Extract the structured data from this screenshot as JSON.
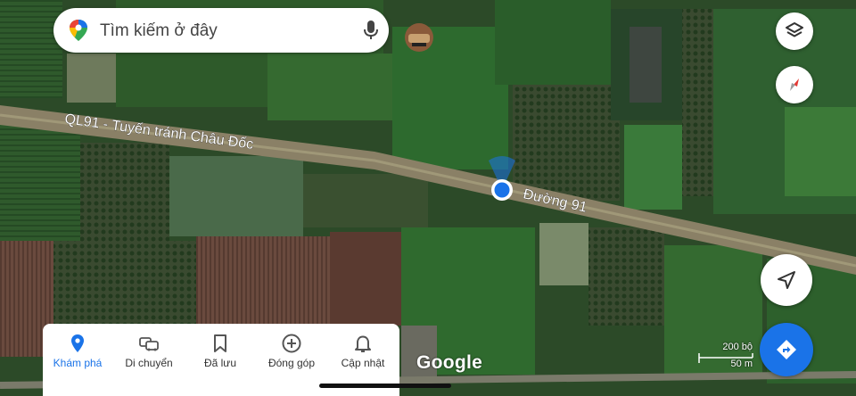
{
  "search": {
    "placeholder": "Tìm kiếm ở đây"
  },
  "map": {
    "road_labels": [
      "QL91 - Tuyến tránh Châu Đốc",
      "Đường 91"
    ],
    "logo": "Google",
    "scale": {
      "top": "200 bộ",
      "bottom": "50 m"
    }
  },
  "bottom_nav": {
    "items": [
      {
        "label": "Khám phá",
        "icon": "explore-pin-icon",
        "active": true
      },
      {
        "label": "Di chuyển",
        "icon": "car-icon",
        "active": false
      },
      {
        "label": "Đã lưu",
        "icon": "bookmark-icon",
        "active": false
      },
      {
        "label": "Đóng góp",
        "icon": "add-circle-icon",
        "active": false
      },
      {
        "label": "Cập nhật",
        "icon": "bell-icon",
        "active": false
      }
    ]
  },
  "colors": {
    "accent": "#1a73e8",
    "location_dot": "#1a73e8"
  }
}
